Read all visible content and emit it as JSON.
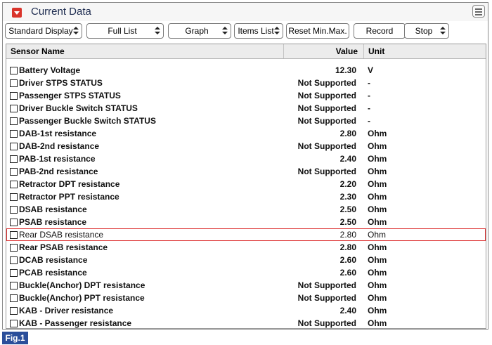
{
  "window": {
    "title": "Current Data",
    "title_icon": "dropdown-icon",
    "menu_icon": "menu-icon",
    "accent_color": "#d9342b"
  },
  "toolbar": {
    "buttons": [
      {
        "label": "Standard Display",
        "has_arrows": true
      },
      {
        "label": "Full List",
        "has_arrows": true
      },
      {
        "label": "Graph",
        "has_arrows": true
      },
      {
        "label": "Items List",
        "has_arrows": true
      },
      {
        "label": "Reset Min.Max.",
        "has_arrows": false
      },
      {
        "label": "Record",
        "has_arrows": false
      },
      {
        "label": "Stop",
        "has_arrows": true
      }
    ]
  },
  "table": {
    "headers": {
      "name": "Sensor Name",
      "value": "Value",
      "unit": "Unit"
    },
    "rows": [
      {
        "name": "Battery Voltage",
        "value": "12.30",
        "unit": "V"
      },
      {
        "name": "Driver STPS STATUS",
        "value": "Not Supported",
        "unit": "-"
      },
      {
        "name": "Passenger STPS STATUS",
        "value": "Not Supported",
        "unit": "-"
      },
      {
        "name": "Driver Buckle Switch STATUS",
        "value": "Not Supported",
        "unit": "-"
      },
      {
        "name": "Passenger Buckle Switch STATUS",
        "value": "Not Supported",
        "unit": "-"
      },
      {
        "name": "DAB-1st resistance",
        "value": "2.80",
        "unit": "Ohm"
      },
      {
        "name": "DAB-2nd resistance",
        "value": "Not Supported",
        "unit": "Ohm"
      },
      {
        "name": "PAB-1st resistance",
        "value": "2.40",
        "unit": "Ohm"
      },
      {
        "name": "PAB-2nd resistance",
        "value": "Not Supported",
        "unit": "Ohm"
      },
      {
        "name": "Retractor DPT resistance",
        "value": "2.20",
        "unit": "Ohm"
      },
      {
        "name": "Retractor PPT resistance",
        "value": "2.30",
        "unit": "Ohm"
      },
      {
        "name": "DSAB resistance",
        "value": "2.50",
        "unit": "Ohm"
      },
      {
        "name": "PSAB resistance",
        "value": "2.50",
        "unit": "Ohm"
      },
      {
        "name": "Rear DSAB resistance",
        "value": "2.80",
        "unit": "Ohm",
        "highlighted": true
      },
      {
        "name": "Rear PSAB resistance",
        "value": "2.80",
        "unit": "Ohm"
      },
      {
        "name": "DCAB resistance",
        "value": "2.60",
        "unit": "Ohm"
      },
      {
        "name": "PCAB resistance",
        "value": "2.60",
        "unit": "Ohm"
      },
      {
        "name": "Buckle(Anchor) DPT resistance",
        "value": "Not Supported",
        "unit": "Ohm"
      },
      {
        "name": "Buckle(Anchor) PPT resistance",
        "value": "Not Supported",
        "unit": "Ohm"
      },
      {
        "name": "KAB - Driver resistance",
        "value": "2.40",
        "unit": "Ohm"
      },
      {
        "name": "KAB - Passenger resistance",
        "value": "Not Supported",
        "unit": "Ohm"
      }
    ],
    "highlight_color": "#dd3333"
  },
  "figure_label": "Fig.1"
}
